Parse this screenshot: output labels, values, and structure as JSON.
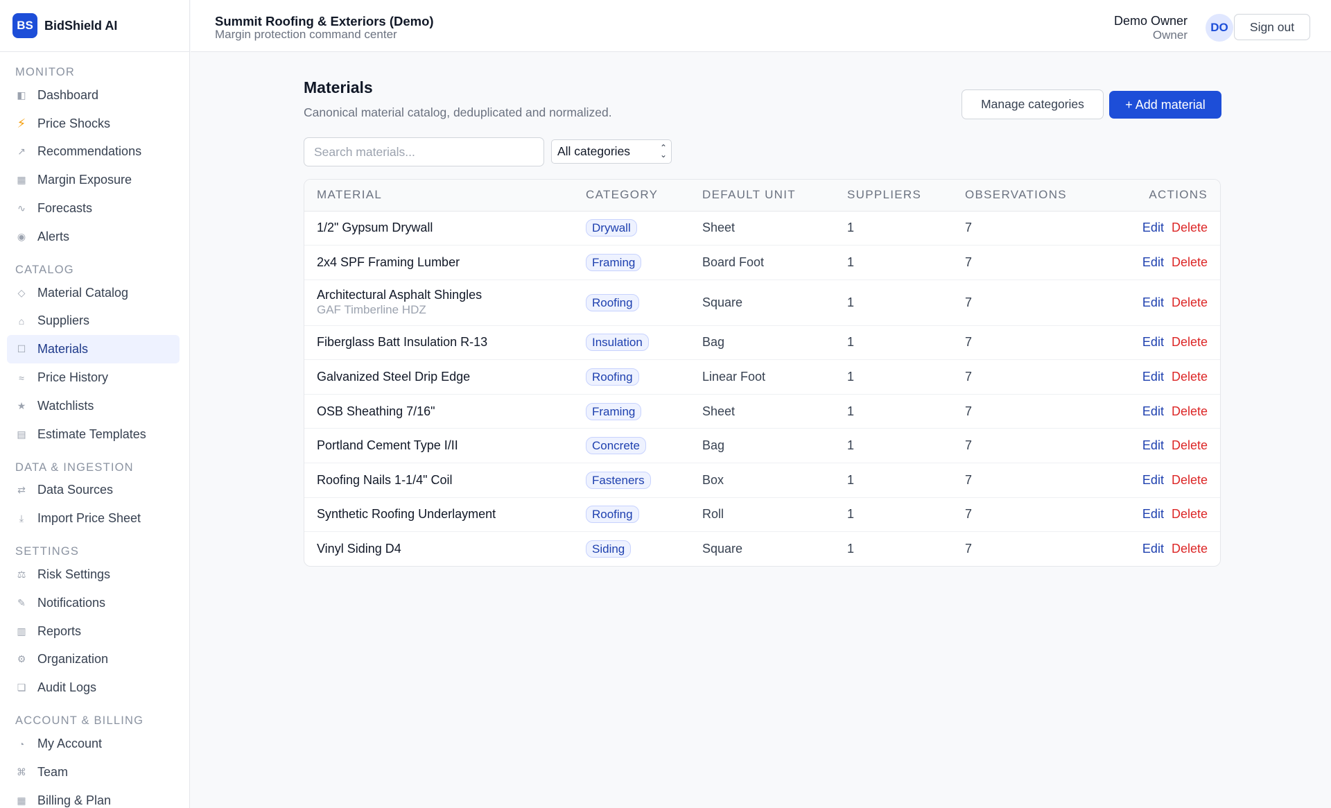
{
  "brand": {
    "logo": "BS",
    "name": "BidShield AI"
  },
  "header": {
    "org_name": "Summit Roofing & Exteriors (Demo)",
    "org_sub": "Margin protection command center",
    "user_name": "Demo Owner",
    "user_role": "Owner",
    "avatar": "DO",
    "signout_label": "Sign out"
  },
  "sidebar": {
    "sections": [
      {
        "title": "MONITOR",
        "items": [
          {
            "label": "Dashboard",
            "icon": "dashboard-icon",
            "glyph": "◧"
          },
          {
            "label": "Price Shocks",
            "icon": "bolt-icon",
            "glyph": "⚡"
          },
          {
            "label": "Recommendations",
            "icon": "arrow-up-right-icon",
            "glyph": "↗"
          },
          {
            "label": "Margin Exposure",
            "icon": "grid-icon",
            "glyph": "▦"
          },
          {
            "label": "Forecasts",
            "icon": "wave-icon",
            "glyph": "∿"
          },
          {
            "label": "Alerts",
            "icon": "dot-icon",
            "glyph": "◉"
          }
        ]
      },
      {
        "title": "CATALOG",
        "items": [
          {
            "label": "Material Catalog",
            "icon": "diamond-icon",
            "glyph": "◇"
          },
          {
            "label": "Suppliers",
            "icon": "home-icon",
            "glyph": "⌂"
          },
          {
            "label": "Materials",
            "icon": "square-icon",
            "glyph": "☐",
            "active": true
          },
          {
            "label": "Price History",
            "icon": "approx-icon",
            "glyph": "≈"
          },
          {
            "label": "Watchlists",
            "icon": "star-icon",
            "glyph": "★"
          },
          {
            "label": "Estimate Templates",
            "icon": "template-icon",
            "glyph": "▤"
          }
        ]
      },
      {
        "title": "DATA & INGESTION",
        "items": [
          {
            "label": "Data Sources",
            "icon": "swap-icon",
            "glyph": "⇄"
          },
          {
            "label": "Import Price Sheet",
            "icon": "download-icon",
            "glyph": "⤓"
          }
        ]
      },
      {
        "title": "SETTINGS",
        "items": [
          {
            "label": "Risk Settings",
            "icon": "scale-icon",
            "glyph": "⚖"
          },
          {
            "label": "Notifications",
            "icon": "pencil-icon",
            "glyph": "✎"
          },
          {
            "label": "Reports",
            "icon": "report-icon",
            "glyph": "▥"
          },
          {
            "label": "Organization",
            "icon": "gear-icon",
            "glyph": "⚙"
          },
          {
            "label": "Audit Logs",
            "icon": "log-icon",
            "glyph": "❏"
          }
        ]
      },
      {
        "title": "ACCOUNT & BILLING",
        "items": [
          {
            "label": "My Account",
            "icon": "user-icon",
            "glyph": "◔"
          },
          {
            "label": "Team",
            "icon": "team-icon",
            "glyph": "⌘"
          },
          {
            "label": "Billing & Plan",
            "icon": "billing-icon",
            "glyph": "▦"
          }
        ]
      }
    ]
  },
  "page": {
    "title": "Materials",
    "subtitle": "Canonical material catalog, deduplicated and normalized.",
    "manage_label": "Manage categories",
    "add_label": "+ Add material",
    "search_placeholder": "Search materials...",
    "category_select": "All categories"
  },
  "table": {
    "headers": [
      "MATERIAL",
      "CATEGORY",
      "DEFAULT UNIT",
      "SUPPLIERS",
      "OBSERVATIONS",
      "ACTIONS"
    ],
    "edit_label": "Edit",
    "delete_label": "Delete",
    "rows": [
      {
        "name": "1/2\" Gypsum Drywall",
        "sub": "",
        "category": "Drywall",
        "unit": "Sheet",
        "suppliers": "1",
        "observations": "7"
      },
      {
        "name": "2x4 SPF Framing Lumber",
        "sub": "",
        "category": "Framing",
        "unit": "Board Foot",
        "suppliers": "1",
        "observations": "7"
      },
      {
        "name": "Architectural Asphalt Shingles",
        "sub": "GAF Timberline HDZ",
        "category": "Roofing",
        "unit": "Square",
        "suppliers": "1",
        "observations": "7"
      },
      {
        "name": "Fiberglass Batt Insulation R-13",
        "sub": "",
        "category": "Insulation",
        "unit": "Bag",
        "suppliers": "1",
        "observations": "7"
      },
      {
        "name": "Galvanized Steel Drip Edge",
        "sub": "",
        "category": "Roofing",
        "unit": "Linear Foot",
        "suppliers": "1",
        "observations": "7"
      },
      {
        "name": "OSB Sheathing 7/16\"",
        "sub": "",
        "category": "Framing",
        "unit": "Sheet",
        "suppliers": "1",
        "observations": "7"
      },
      {
        "name": "Portland Cement Type I/II",
        "sub": "",
        "category": "Concrete",
        "unit": "Bag",
        "suppliers": "1",
        "observations": "7"
      },
      {
        "name": "Roofing Nails 1-1/4\" Coil",
        "sub": "",
        "category": "Fasteners",
        "unit": "Box",
        "suppliers": "1",
        "observations": "7"
      },
      {
        "name": "Synthetic Roofing Underlayment",
        "sub": "",
        "category": "Roofing",
        "unit": "Roll",
        "suppliers": "1",
        "observations": "7"
      },
      {
        "name": "Vinyl Siding D4",
        "sub": "",
        "category": "Siding",
        "unit": "Square",
        "suppliers": "1",
        "observations": "7"
      }
    ]
  },
  "colors": {
    "accent": "#1d4ed8",
    "danger": "#dc2626",
    "badge_bg": "#eef2ff"
  }
}
